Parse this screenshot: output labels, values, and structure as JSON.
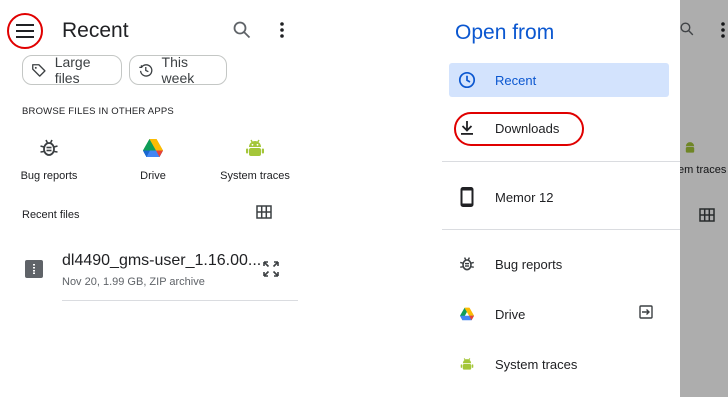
{
  "left": {
    "title": "Recent",
    "chips": [
      {
        "label": "Large files",
        "icon": "label-icon"
      },
      {
        "label": "This week",
        "icon": "history-icon"
      }
    ],
    "browse_caption": "BROWSE FILES IN OTHER APPS",
    "apps": [
      {
        "label": "Bug reports",
        "icon": "bug-report-icon"
      },
      {
        "label": "Drive",
        "icon": "drive-icon"
      },
      {
        "label": "System traces",
        "icon": "android-icon"
      }
    ],
    "recent_files_label": "Recent files",
    "file": {
      "name": "dl4490_gms-user_1.16.00...",
      "meta": "Nov 20, 1.99 GB, ZIP archive"
    }
  },
  "right": {
    "drawer_title": "Open from",
    "items": [
      {
        "label": "Recent",
        "icon": "clock-icon",
        "active": true
      },
      {
        "label": "Downloads",
        "icon": "download-icon",
        "active": false
      },
      {
        "label": "Memor 12",
        "icon": "phone-icon",
        "active": false
      },
      {
        "label": "Bug reports",
        "icon": "bug-report-icon",
        "active": false
      },
      {
        "label": "Drive",
        "icon": "drive-icon",
        "active": false
      },
      {
        "label": "System traces",
        "icon": "android-icon",
        "active": false
      }
    ],
    "peek_label": "tem traces"
  },
  "colors": {
    "accent": "#0b57d0",
    "active_bg": "#d3e3fd",
    "highlight": "#e00000",
    "android_green": "#a4c639"
  }
}
